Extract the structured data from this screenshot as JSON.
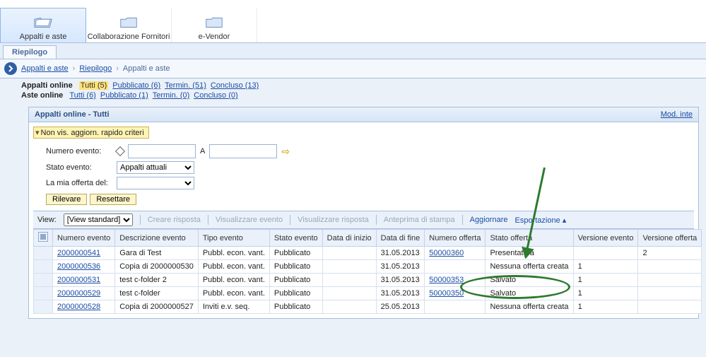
{
  "toolbar": {
    "items": [
      {
        "label": "Appalti e aste"
      },
      {
        "label": "Collaborazione Fornitori"
      },
      {
        "label": "e-Vendor"
      }
    ]
  },
  "subtab": {
    "label": "Riepilogo"
  },
  "breadcrumb": {
    "parts": [
      "Appalti e aste",
      "Riepilogo",
      "Appalti e aste"
    ]
  },
  "filters": {
    "appalti_label": "Appalti online",
    "aste_label": "Aste online",
    "appalti_links": [
      {
        "label": "Tutti (5)",
        "active": true
      },
      {
        "label": "Pubblicato (6)"
      },
      {
        "label": "Termin. (51)"
      },
      {
        "label": "Concluso (13)"
      }
    ],
    "aste_links": [
      {
        "label": "Tutti (6)"
      },
      {
        "label": "Pubblicato (1)"
      },
      {
        "label": "Termin. (0)"
      },
      {
        "label": "Concluso (0)"
      }
    ]
  },
  "panel": {
    "title": "Appalti online - Tutti",
    "modlink": "Mod. inte",
    "toggle": "Non vis. aggiorn. rapido criteri",
    "criteria": {
      "numero_label": "Numero evento:",
      "a_label": "A",
      "stato_label": "Stato evento:",
      "stato_value": "Appalti attuali",
      "offerta_label": "La mia offerta del:"
    },
    "buttons": {
      "rilevare": "Rilevare",
      "resettare": "Resettare"
    },
    "viewbar": {
      "view_label": "View:",
      "view_value": "[View standard]",
      "creare": "Creare risposta",
      "vis_evento": "Visualizzare evento",
      "vis_risposta": "Visualizzare risposta",
      "anteprima": "Anteprima di stampa",
      "aggiornare": "Aggiornare",
      "esportazione": "Esportazione"
    },
    "columns": [
      "Numero evento",
      "Descrizione evento",
      "Tipo evento",
      "Stato evento",
      "Data di inizio",
      "Data di fine",
      "Numero offerta",
      "Stato offerta",
      "Versione evento",
      "Versione offerta"
    ],
    "rows": [
      {
        "num": "2000000541",
        "desc": "Gara di Test",
        "tipo": "Pubbl. econ. vant.",
        "stato": "Pubblicato",
        "inizio": "",
        "fine": "31.05.2013",
        "noff": "50000360",
        "soff": "Presentato/a",
        "ve": "",
        "vo": "2"
      },
      {
        "num": "2000000536",
        "desc": "Copia di 2000000530",
        "tipo": "Pubbl. econ. vant.",
        "stato": "Pubblicato",
        "inizio": "",
        "fine": "31.05.2013",
        "noff": "",
        "soff": "Nessuna offerta creata",
        "ve": "1",
        "vo": ""
      },
      {
        "num": "2000000531",
        "desc": "test c-folder 2",
        "tipo": "Pubbl. econ. vant.",
        "stato": "Pubblicato",
        "inizio": "",
        "fine": "31.05.2013",
        "noff": "50000353",
        "soff": "Salvato",
        "ve": "1",
        "vo": ""
      },
      {
        "num": "2000000529",
        "desc": "test c-folder",
        "tipo": "Pubbl. econ. vant.",
        "stato": "Pubblicato",
        "inizio": "",
        "fine": "31.05.2013",
        "noff": "50000350",
        "soff": "Salvato",
        "ve": "1",
        "vo": ""
      },
      {
        "num": "2000000528",
        "desc": "Copia di 2000000527",
        "tipo": "Inviti e.v. seq.",
        "stato": "Pubblicato",
        "inizio": "",
        "fine": "25.05.2013",
        "noff": "",
        "soff": "Nessuna offerta creata",
        "ve": "1",
        "vo": ""
      }
    ]
  }
}
